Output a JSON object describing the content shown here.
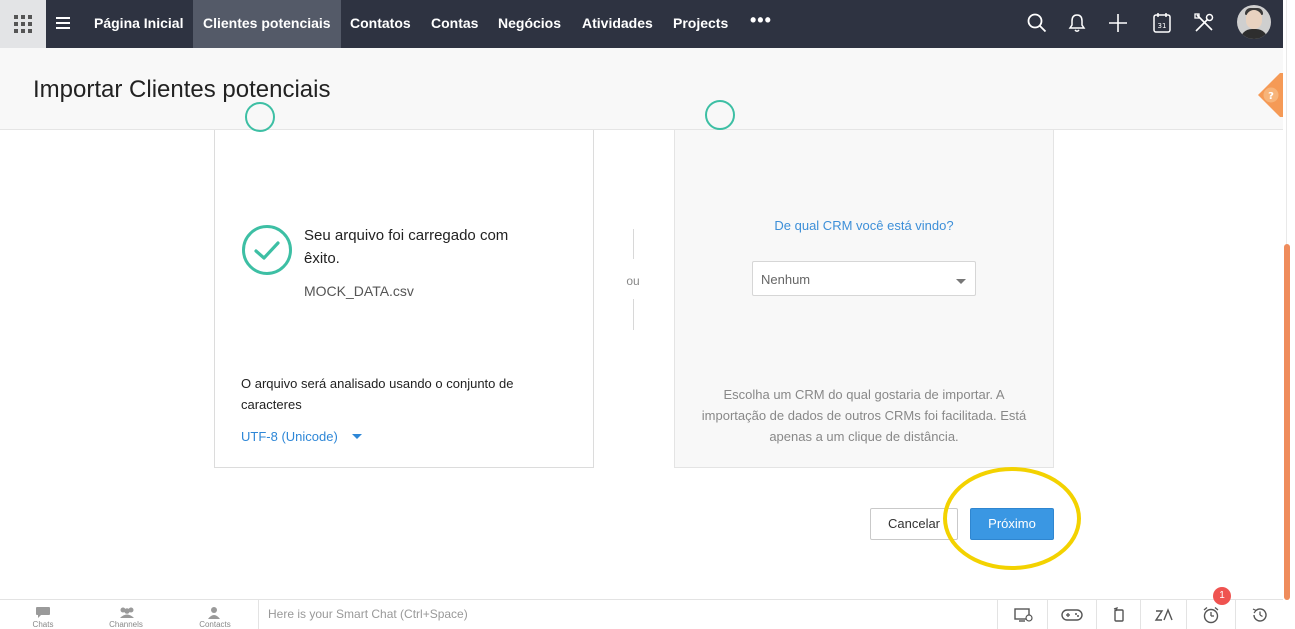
{
  "topnav": {
    "items": [
      {
        "label": "Página Inicial"
      },
      {
        "label": "Clientes potenciais",
        "active": true
      },
      {
        "label": "Contatos"
      },
      {
        "label": "Contas"
      },
      {
        "label": "Negócios"
      },
      {
        "label": "Atividades"
      },
      {
        "label": "Projects"
      }
    ],
    "more_label": "•••",
    "icons": [
      "search-icon",
      "bell-icon",
      "plus-icon",
      "calendar-icon",
      "tools-icon",
      "avatar"
    ],
    "calendar_day": "31"
  },
  "header": {
    "title": "Importar Clientes potenciais",
    "help_label": "?"
  },
  "upload_card": {
    "success_message": "Seu arquivo foi carregado com êxito.",
    "file_name": "MOCK_DATA.csv",
    "charset_text": "O arquivo será analisado usando o conjunto de caracteres",
    "charset_value": "UTF-8 (Unicode)"
  },
  "separator": {
    "label": "ou"
  },
  "crm_card": {
    "question": "De qual CRM você está vindo?",
    "select_value": "Nenhum",
    "help_text": "Escolha um CRM do qual gostaria de importar. A importação de dados de outros CRMs foi facilitada. Está apenas a um clique de distância."
  },
  "actions": {
    "cancel_label": "Cancelar",
    "next_label": "Próximo"
  },
  "bottombar": {
    "items": [
      {
        "label": "Chats"
      },
      {
        "label": "Channels"
      },
      {
        "label": "Contacts"
      }
    ],
    "chat_placeholder": "Here is your Smart Chat (Ctrl+Space)",
    "notification_count": "1"
  },
  "colors": {
    "nav_bg": "#2e3341",
    "accent_blue": "#3a97e3",
    "success_green": "#3dbfa4",
    "help_orange": "#ef8c5c",
    "highlight_yellow": "#f3d200"
  }
}
